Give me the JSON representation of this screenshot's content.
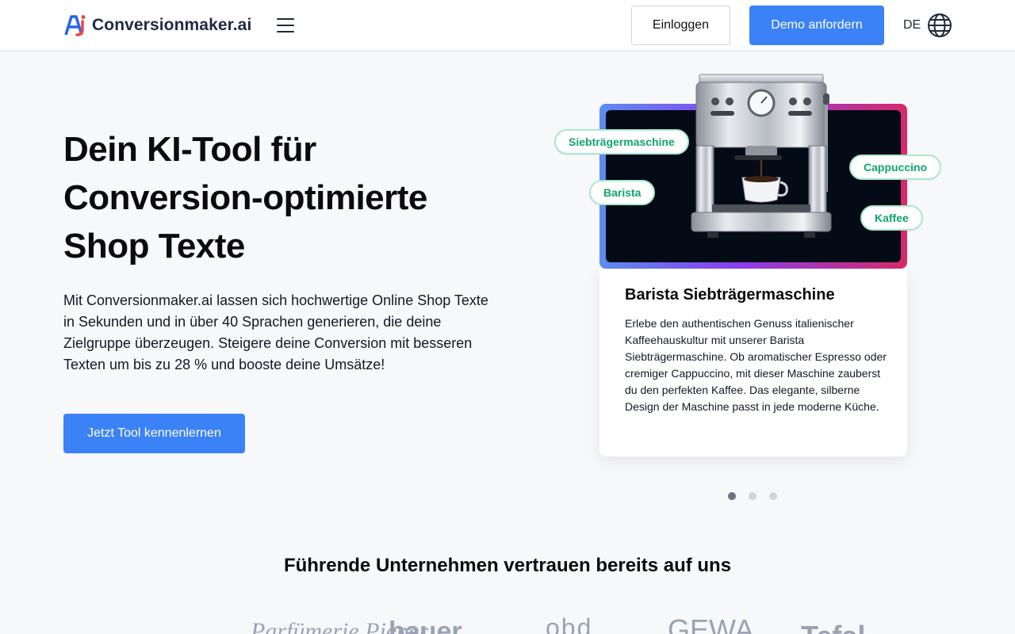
{
  "header": {
    "logo_text": "Conversionmaker.ai",
    "login_label": "Einloggen",
    "demo_label": "Demo anfordern",
    "lang_code": "DE"
  },
  "hero": {
    "title_line1": "Dein KI-Tool für",
    "title_line2": "Conversion-optimierte",
    "title_line3": "Shop Texte",
    "text": "Mit Conversionmaker.ai lassen sich hochwertige Online Shop Texte in Sekunden und in über 40 Sprachen generieren, die deine Zielgruppe überzeugen. Steigere deine Conversion mit besseren Texten um bis zu 28 % und booste deine Umsätze!",
    "cta_label": "Jetzt Tool kennenlernen"
  },
  "showcase": {
    "chips": [
      "Siebträgermaschine",
      "Barista",
      "Cappuccino",
      "Kaffee"
    ],
    "card_title": "Barista Siebträgermaschine",
    "card_text": "Erlebe den authentischen Genuss italienischer Kaffeehauskultur mit unserer Barista Siebträgermaschine. Ob aromatischer Espresso oder cremiger Cappuccino, mit dieser Maschine zauberst du den perfekten Kaffee. Das elegante, silberne Design der Maschine passt in jede moderne Küche.",
    "slides": 3,
    "active_slide": 1
  },
  "trust": {
    "title": "Führende Unternehmen vertrauen bereits auf uns",
    "logos": [
      "Parfümerie Pieper",
      "bauer",
      "obd",
      "GEWA",
      "Tefal"
    ]
  },
  "colors": {
    "accent": "#3b82f6",
    "chip_text": "#10a56b",
    "chip_border": "#a7e9c9"
  }
}
